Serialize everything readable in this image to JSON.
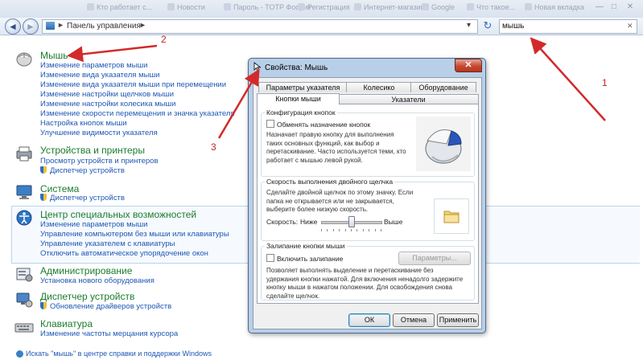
{
  "browser_tabs": [
    {
      "label": "Кто работает с..."
    },
    {
      "label": "Новости"
    },
    {
      "label": "Пароль - TOTP Фоорит"
    },
    {
      "label": "Регистрация"
    },
    {
      "label": "Интернет-магазин"
    },
    {
      "label": "Google"
    },
    {
      "label": "Что такое..."
    },
    {
      "label": "Новая вкладка"
    }
  ],
  "window_controls": {
    "minimize": "—",
    "maximize": "□",
    "close": "✕"
  },
  "address": {
    "back": "◄",
    "forward": "►",
    "path": "Панель управления",
    "separator": "►",
    "dropdown": "▾",
    "refresh": "↻",
    "search_value": "мышь",
    "clear": "✕"
  },
  "results": {
    "mouse": {
      "title": "Мышь",
      "links": [
        "Изменение параметров мыши",
        "Изменение вида указателя мыши",
        "Изменение вида указателя мыши при перемещении",
        "Изменение настройки щелчков мыши",
        "Изменение настройки колесика мыши",
        "Изменение скорости перемещения и значка указателя",
        "Настройка кнопок мыши",
        "Улучшение видимости указателя"
      ]
    },
    "devices": {
      "title": "Устройства и принтеры",
      "links": [
        "Просмотр устройств и принтеров",
        "Диспетчер устройств"
      ]
    },
    "system": {
      "title": "Система",
      "links": [
        "Диспетчер устройств"
      ]
    },
    "accessibility": {
      "title": "Центр специальных возможностей",
      "links": [
        "Изменение параметров мыши",
        "Управление компьютером без мыши или клавиатуры",
        "Управление указателем с клавиатуры",
        "Отключить автоматическое упорядочение окон"
      ]
    },
    "admin": {
      "title": "Администрирование",
      "links": [
        "Установка нового оборудования"
      ]
    },
    "devmgr": {
      "title": "Диспетчер устройств",
      "links": [
        "Обновление драйверов устройств"
      ]
    },
    "keyboard": {
      "title": "Клавиатура",
      "links": [
        "Изменение частоты мерцания курсора"
      ]
    },
    "help": "Искать \"мышь\" в центре справки и поддержки Windows"
  },
  "annotations": [
    "1",
    "2",
    "3"
  ],
  "dialog": {
    "title": "Свойства: Мышь",
    "close": "✕",
    "tabs_back": [
      "Параметры указателя",
      "Колесико",
      "Оборудование"
    ],
    "tabs_front": [
      "Кнопки мыши",
      "Указатели"
    ],
    "button_config": {
      "title": "Конфигурация кнопок",
      "checkbox": "Обменять назначение кнопок",
      "description": "Назначает правую кнопку для выполнения таких основных функций, как выбор и перетаскивание. Часто используется теми, кто работает с мышью левой рукой."
    },
    "double_click": {
      "title": "Скорость выполнения двойного щелчка",
      "description": "Сделайте двойной щелчок по этому значку. Если папка не открывается или не закрывается, выберите более низкую скорость.",
      "speed_label": "Скорость:",
      "slow": "Ниже",
      "fast": "Выше",
      "slider_value": 0.5
    },
    "click_lock": {
      "title": "Залипание кнопки мыши",
      "checkbox": "Включить залипание",
      "params_button": "Параметры...",
      "description": "Позволяет выполнять выделение и перетаскивание без удержания кнопки нажатой. Для включения ненадолго задержите кнопку мыши в нажатом положении. Для освобождения снова сделайте щелчок."
    },
    "buttons": {
      "ok": "ОК",
      "cancel": "Отмена",
      "apply": "Применить"
    }
  },
  "colors": {
    "category_green": "#1b7c2e",
    "link_blue": "#1e57b6",
    "annotation_red": "#c62424"
  }
}
